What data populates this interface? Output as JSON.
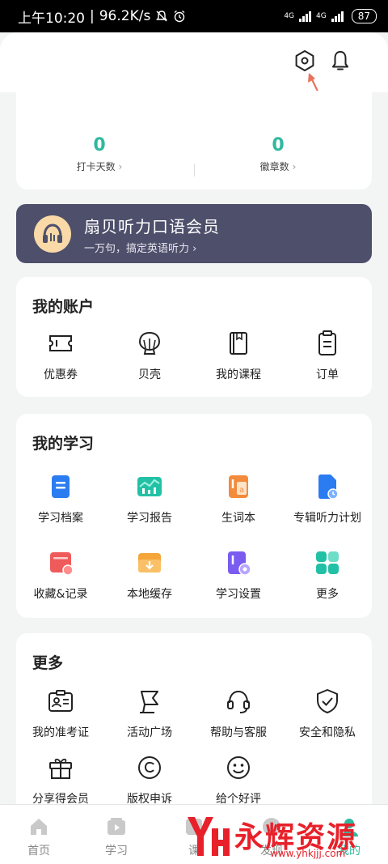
{
  "status_bar": {
    "time": "上午10:20",
    "speed": "96.2K/s",
    "signal_1": "4G",
    "signal_2": "4G",
    "battery": "87"
  },
  "stats": [
    {
      "value": "0",
      "label": "打卡天数"
    },
    {
      "value": "0",
      "label": "徽章数"
    }
  ],
  "vip": {
    "title": "扇贝听力口语会员",
    "subtitle": "一万句，搞定英语听力"
  },
  "account": {
    "title": "我的账户",
    "items": [
      {
        "label": "优惠券",
        "icon": "coupon-icon"
      },
      {
        "label": "贝壳",
        "icon": "shell-icon"
      },
      {
        "label": "我的课程",
        "icon": "course-book-icon"
      },
      {
        "label": "订单",
        "icon": "order-icon"
      }
    ]
  },
  "study": {
    "title": "我的学习",
    "items": [
      {
        "label": "学习档案",
        "icon": "study-file-icon"
      },
      {
        "label": "学习报告",
        "icon": "study-report-icon"
      },
      {
        "label": "生词本",
        "icon": "vocab-book-icon"
      },
      {
        "label": "专辑听力计划",
        "icon": "listening-plan-icon"
      },
      {
        "label": "收藏&记录",
        "icon": "favorites-icon"
      },
      {
        "label": "本地缓存",
        "icon": "local-cache-icon"
      },
      {
        "label": "学习设置",
        "icon": "study-settings-icon"
      },
      {
        "label": "更多",
        "icon": "more-grid-icon"
      }
    ]
  },
  "more": {
    "title": "更多",
    "items": [
      {
        "label": "我的准考证",
        "icon": "admission-ticket-icon"
      },
      {
        "label": "活动广场",
        "icon": "activity-flag-icon"
      },
      {
        "label": "帮助与客服",
        "icon": "headset-icon"
      },
      {
        "label": "安全和隐私",
        "icon": "shield-icon"
      },
      {
        "label": "分享得会员",
        "icon": "gift-icon"
      },
      {
        "label": "版权申诉",
        "icon": "copyright-icon"
      },
      {
        "label": "给个好评",
        "icon": "smile-icon"
      }
    ]
  },
  "tabbar": {
    "tabs": [
      {
        "label": "首页",
        "icon": "home-icon"
      },
      {
        "label": "学习",
        "icon": "play-icon"
      },
      {
        "label": "课",
        "icon": "course-icon"
      },
      {
        "label": "发现",
        "icon": "discover-icon"
      },
      {
        "label": "我的",
        "icon": "profile-icon"
      }
    ]
  },
  "watermark": {
    "text": "永辉资源网",
    "url": "www.yhkjjj.com"
  },
  "colors": {
    "accent": "#2fb8a0",
    "vip_bg": "#4e4f6b",
    "vip_logo": "#f9d9a7",
    "watermark": "#e8202a"
  }
}
